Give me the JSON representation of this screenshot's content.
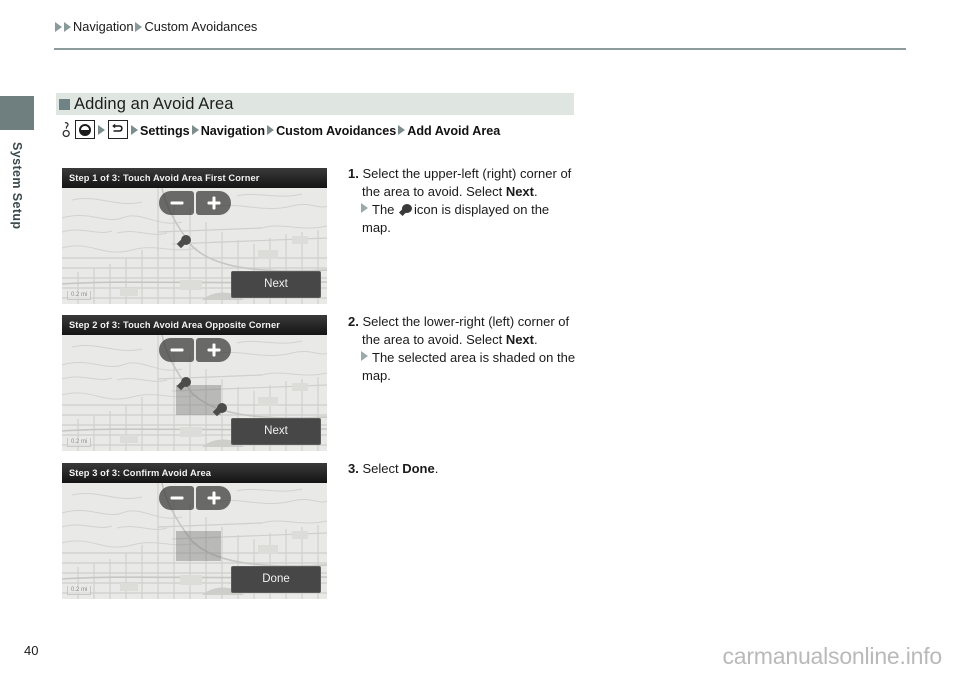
{
  "breadcrumb": {
    "items": [
      "Navigation",
      "Custom Avoidances"
    ],
    "icon_names": [
      "triangle-marker",
      "triangle-marker"
    ]
  },
  "sidebar": {
    "tab_label": "System Setup",
    "block_color": "#6f7f80"
  },
  "section": {
    "title": "Adding an Avoid Area",
    "bar_color": "#dfe6e2",
    "square_color": "#6f8384"
  },
  "path": {
    "icons": [
      "hand-icon",
      "home-button-icon",
      "back-button-icon"
    ],
    "segments": [
      "Settings",
      "Navigation",
      "Custom Avoidances",
      "Add Avoid Area"
    ]
  },
  "steps": [
    {
      "number": "1.",
      "text_before": "Select the upper-left (right) corner of the area to avoid. Select ",
      "bold": "Next",
      "text_after": ".",
      "sub_before": "The ",
      "sub_icon": "map-pin-icon",
      "sub_after": "icon is displayed on the map."
    },
    {
      "number": "2.",
      "text_before": "Select the lower-right (left) corner of the area to avoid. Select ",
      "bold": "Next",
      "text_after": ".",
      "sub_before": "The selected area is shaded on the map.",
      "sub_icon": "",
      "sub_after": ""
    },
    {
      "number": "3.",
      "text_before": "Select ",
      "bold": "Done",
      "text_after": ".",
      "sub_before": "",
      "sub_icon": "",
      "sub_after": ""
    }
  ],
  "panels": [
    {
      "title": "Step 1 of 3: Touch Avoid Area First Corner",
      "button_label": "Next",
      "scale_label": "0.2 mi",
      "zoom_out_icon": "minus-icon",
      "zoom_in_icon": "plus-icon",
      "pins": 1,
      "shaded_area": false
    },
    {
      "title": "Step 2 of 3: Touch Avoid Area Opposite Corner",
      "button_label": "Next",
      "scale_label": "0.2 mi",
      "zoom_out_icon": "minus-icon",
      "zoom_in_icon": "plus-icon",
      "pins": 2,
      "shaded_area": true
    },
    {
      "title": "Step 3 of 3: Confirm Avoid Area",
      "button_label": "Done",
      "scale_label": "0.2 mi",
      "zoom_out_icon": "minus-icon",
      "zoom_in_icon": "plus-icon",
      "pins": 0,
      "shaded_area": true
    }
  ],
  "footer": {
    "page_number": "40",
    "watermark": "carmanualsonline.info"
  }
}
